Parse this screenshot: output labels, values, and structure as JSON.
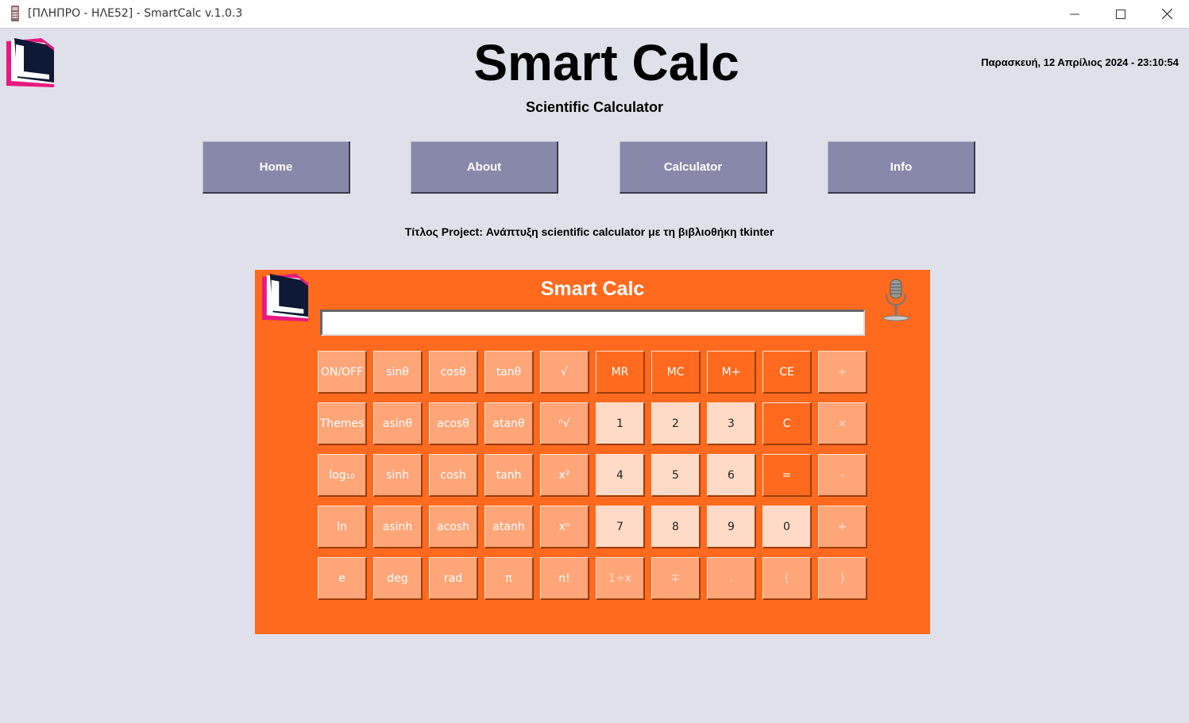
{
  "window": {
    "title": "[ΠΛΗΠΡΟ - ΗΛΕ52] - SmartCalc v.1.0.3",
    "minimize_icon": "minimize-icon",
    "maximize_icon": "maximize-icon",
    "close_icon": "close-icon"
  },
  "header": {
    "title": "Smart Calc",
    "subtitle": "Scientific Calculator",
    "datetime": "Παρασκευή, 12 Απρίλιος 2024 - 23:10:54"
  },
  "nav": [
    {
      "label": "Home"
    },
    {
      "label": "About"
    },
    {
      "label": "Calculator"
    },
    {
      "label": "Info"
    }
  ],
  "project_title": "Τίτλος Project: Ανάπτυξη scientific calculator με τη βιβλιοθήκη tkinter",
  "calculator": {
    "title": "Smart Calc",
    "display_value": "",
    "accent_color": "#ff6a1e",
    "mic_icon": "microphone-icon",
    "keys": [
      {
        "label": "ON/OFF",
        "style": "light"
      },
      {
        "label": "sinθ",
        "style": "light"
      },
      {
        "label": "cosθ",
        "style": "light"
      },
      {
        "label": "tanθ",
        "style": "light"
      },
      {
        "label": "√",
        "style": "light"
      },
      {
        "label": "MR",
        "style": "dark"
      },
      {
        "label": "MC",
        "style": "dark"
      },
      {
        "label": "M+",
        "style": "dark"
      },
      {
        "label": "CE",
        "style": "dark"
      },
      {
        "label": "÷",
        "style": "light-faint"
      },
      {
        "label": "Themes",
        "style": "light"
      },
      {
        "label": "asinθ",
        "style": "light"
      },
      {
        "label": "acosθ",
        "style": "light"
      },
      {
        "label": "atanθ",
        "style": "light"
      },
      {
        "label": "ⁿ√",
        "style": "light"
      },
      {
        "label": "1",
        "style": "pale"
      },
      {
        "label": "2",
        "style": "pale"
      },
      {
        "label": "3",
        "style": "pale"
      },
      {
        "label": "C",
        "style": "dark"
      },
      {
        "label": "×",
        "style": "light-faint"
      },
      {
        "label": "log₁₀",
        "style": "light"
      },
      {
        "label": "sinh",
        "style": "light"
      },
      {
        "label": "cosh",
        "style": "light"
      },
      {
        "label": "tanh",
        "style": "light"
      },
      {
        "label": "x²",
        "style": "light"
      },
      {
        "label": "4",
        "style": "pale"
      },
      {
        "label": "5",
        "style": "pale"
      },
      {
        "label": "6",
        "style": "pale"
      },
      {
        "label": "=",
        "style": "dark"
      },
      {
        "label": "-",
        "style": "light-faint"
      },
      {
        "label": "ln",
        "style": "light"
      },
      {
        "label": "asinh",
        "style": "light"
      },
      {
        "label": "acosh",
        "style": "light"
      },
      {
        "label": "atanh",
        "style": "light"
      },
      {
        "label": "xⁿ",
        "style": "light"
      },
      {
        "label": "7",
        "style": "pale"
      },
      {
        "label": "8",
        "style": "pale"
      },
      {
        "label": "9",
        "style": "pale"
      },
      {
        "label": "0",
        "style": "pale"
      },
      {
        "label": "+",
        "style": "light-faint"
      },
      {
        "label": "e",
        "style": "light"
      },
      {
        "label": "deg",
        "style": "light"
      },
      {
        "label": "rad",
        "style": "light"
      },
      {
        "label": "π",
        "style": "light"
      },
      {
        "label": "n!",
        "style": "light"
      },
      {
        "label": "1÷x",
        "style": "light-faint"
      },
      {
        "label": "∓",
        "style": "light-faint"
      },
      {
        "label": ".",
        "style": "light-faint"
      },
      {
        "label": "(",
        "style": "light-faint"
      },
      {
        "label": ")",
        "style": "light-faint"
      }
    ]
  }
}
